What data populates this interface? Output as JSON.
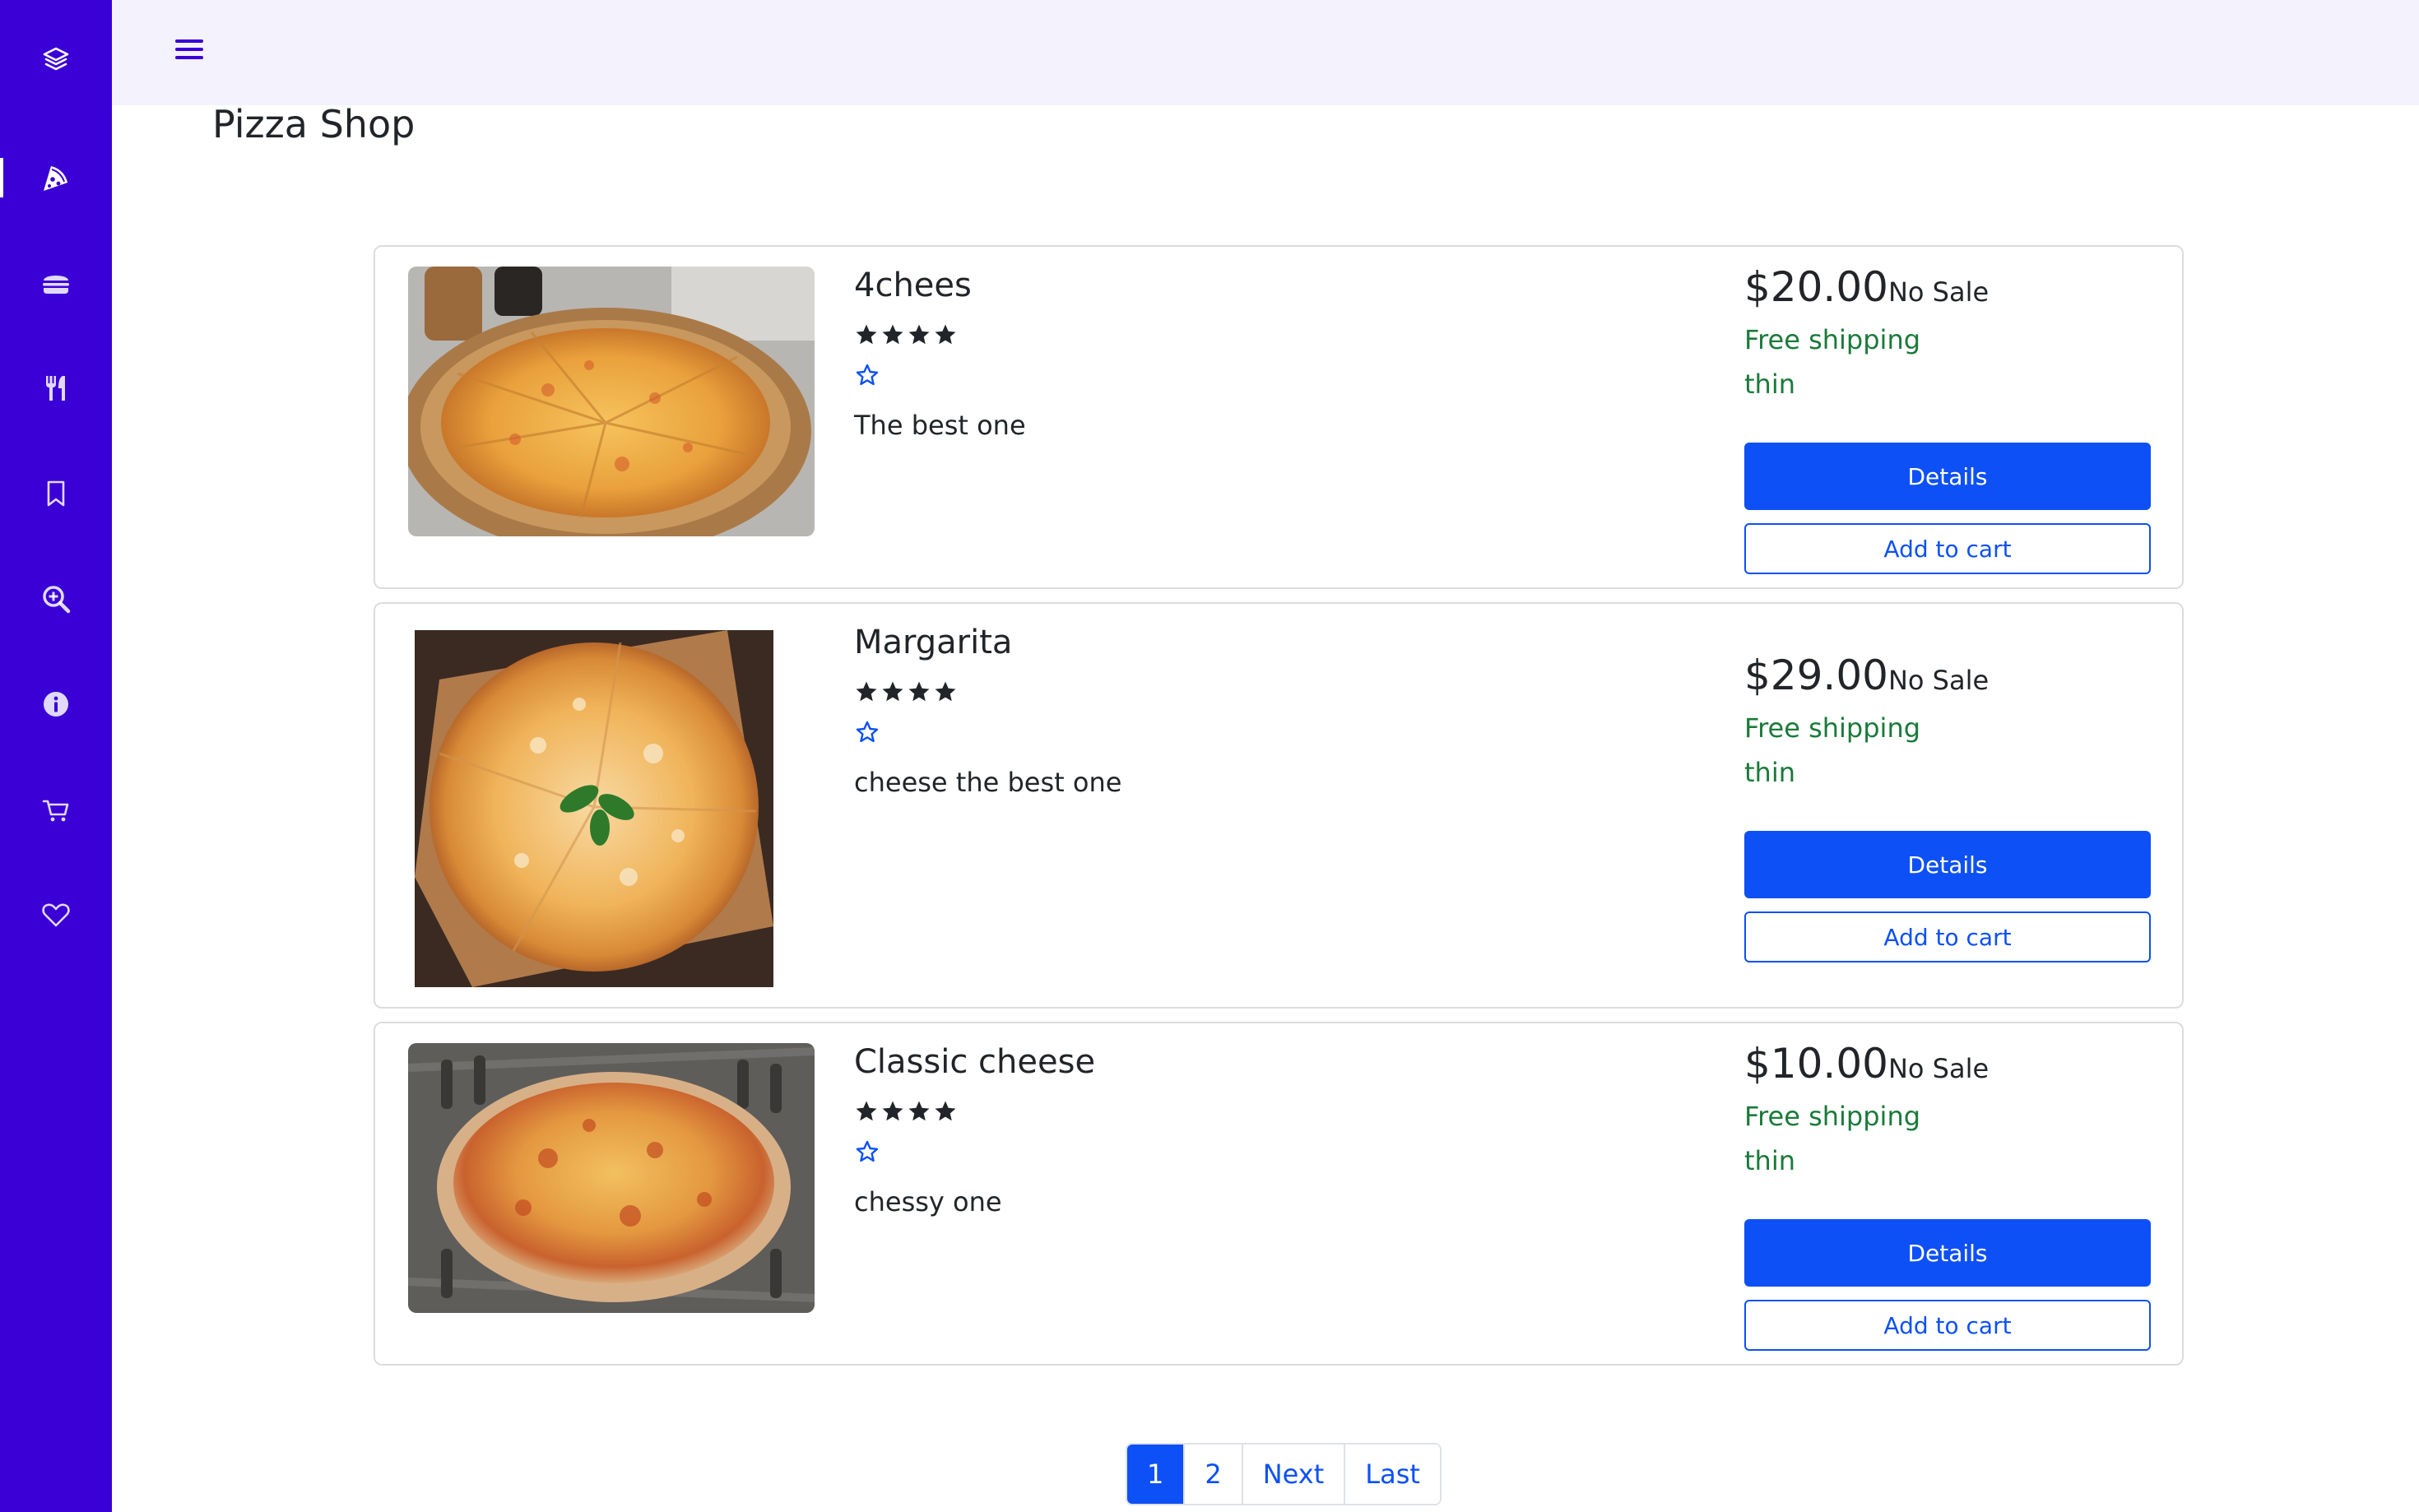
{
  "app": {
    "title": "Pizza Shop"
  },
  "sidebar": {
    "items": [
      {
        "icon": "layers-icon",
        "active": false
      },
      {
        "icon": "pizza-icon",
        "active": true
      },
      {
        "icon": "burger-icon",
        "active": false
      },
      {
        "icon": "utensils-icon",
        "active": false
      },
      {
        "icon": "bookmark-icon",
        "active": false
      },
      {
        "icon": "search-plus-icon",
        "active": false
      },
      {
        "icon": "info-icon",
        "active": false
      },
      {
        "icon": "cart-icon",
        "active": false
      },
      {
        "icon": "heart-icon",
        "active": false
      }
    ]
  },
  "header": {
    "menu_icon": "hamburger-icon"
  },
  "products": [
    {
      "name": "4chees",
      "rating": 4,
      "description": "The best one",
      "price": "$20.00",
      "sale": "No Sale",
      "shipping": "Free shipping",
      "crust": "thin",
      "details_label": "Details",
      "cart_label": "Add to cart"
    },
    {
      "name": "Margarita",
      "rating": 4,
      "description": "cheese the best one",
      "price": "$29.00",
      "sale": "No Sale",
      "shipping": "Free shipping",
      "crust": "thin",
      "details_label": "Details",
      "cart_label": "Add to cart"
    },
    {
      "name": "Classic cheese",
      "rating": 4,
      "description": "chessy one",
      "price": "$10.00",
      "sale": "No Sale",
      "shipping": "Free shipping",
      "crust": "thin",
      "details_label": "Details",
      "cart_label": "Add to cart"
    }
  ],
  "pagination": {
    "pages": [
      "1",
      "2"
    ],
    "current": "1",
    "next_label": "Next",
    "last_label": "Last"
  },
  "colors": {
    "sidebar": "#3a00d6",
    "primary": "#0d50f5",
    "shipping": "#1a7a3a",
    "header_bg": "#f4f2fd"
  }
}
